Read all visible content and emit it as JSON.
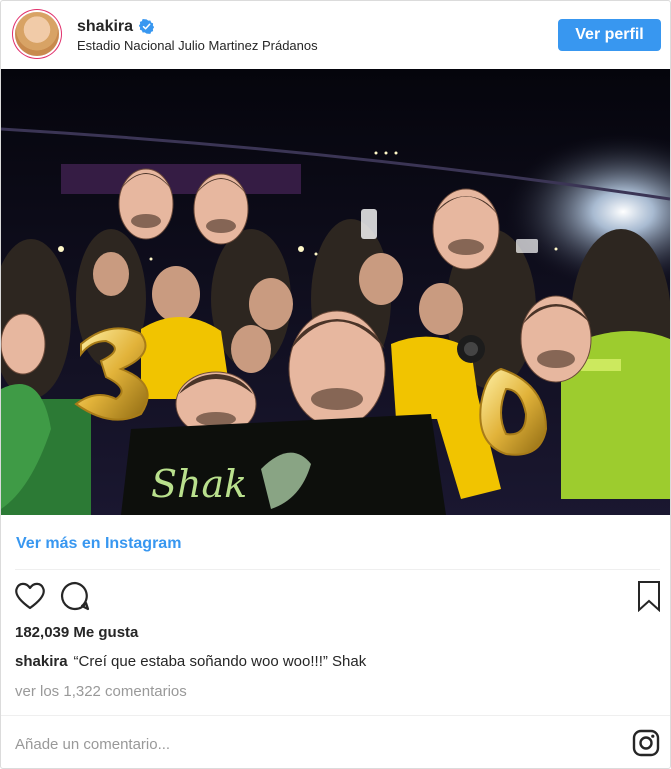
{
  "post": {
    "username": "shakira",
    "location": "Estadio Nacional Julio Martinez Prádanos",
    "view_profile_label": "Ver perfil",
    "view_more_label": "Ver más en Instagram",
    "likes_text": "182,039 Me gusta",
    "caption_user": "shakira",
    "caption_text": "“Creí que estaba soñando woo woo!!!” Shak",
    "comments_link": "ver los 1,322 comentarios",
    "add_comment_placeholder": "Añade un comentario..."
  },
  "photo": {
    "banner_text": "Shak",
    "balloon_text": "30"
  },
  "icons": {
    "verified": "verified-badge-icon",
    "like": "heart-outline-icon",
    "comment": "speech-bubble-icon",
    "save": "bookmark-outline-icon",
    "brand": "instagram-logo-icon"
  },
  "colors": {
    "accent": "#3897f0",
    "text": "#262626",
    "muted": "#999999",
    "border": "#dbdbdb"
  }
}
